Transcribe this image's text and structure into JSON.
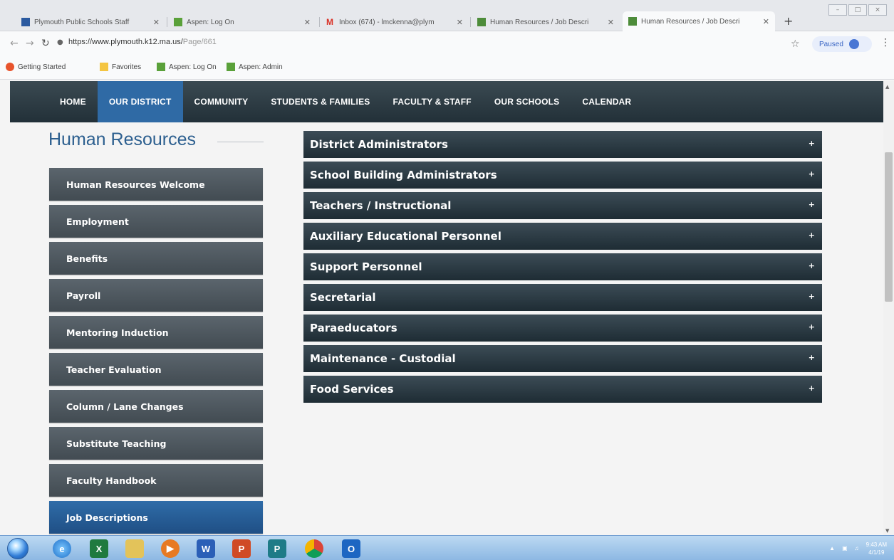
{
  "browser": {
    "tabs": [
      {
        "title": "Plymouth Public Schools Staff",
        "active": false
      },
      {
        "title": "Aspen: Log On",
        "active": false
      },
      {
        "title": "Inbox (674) - lmckenna@plym",
        "active": false
      },
      {
        "title": "Human Resources / Job Descri",
        "active": false
      },
      {
        "title": "Human Resources / Job Descri",
        "active": true
      }
    ],
    "new_tab": "+",
    "url_main": "https://www.plymouth.k12.ma.us/",
    "url_path": "Page/661",
    "profile_label": "Paused",
    "bookmarks": [
      "Getting Started",
      "Favorites",
      "Aspen: Log On",
      "Aspen: Admin"
    ]
  },
  "site_nav": {
    "items": [
      "HOME",
      "OUR DISTRICT",
      "COMMUNITY",
      "STUDENTS & FAMILIES",
      "FACULTY & STAFF",
      "OUR SCHOOLS",
      "CALENDAR"
    ],
    "active": "OUR DISTRICT"
  },
  "sidebar": {
    "title": "Human Resources",
    "items": [
      "Human Resources Welcome",
      "Employment",
      "Benefits",
      "Payroll",
      "Mentoring Induction",
      "Teacher Evaluation",
      "Column / Lane Changes",
      "Substitute Teaching",
      "Faculty Handbook",
      "Job Descriptions"
    ],
    "active": "Job Descriptions"
  },
  "accordion": {
    "items": [
      "District Administrators",
      "School Building Administrators",
      "Teachers / Instructional",
      "Auxiliary Educational Personnel",
      "Support Personnel",
      "Secretarial",
      "Paraeducators",
      "Maintenance - Custodial",
      "Food Services"
    ],
    "expand_symbol": "+"
  },
  "taskbar": {
    "apps": [
      "internet-explorer",
      "excel",
      "file-explorer",
      "media-player",
      "word",
      "powerpoint",
      "publisher",
      "chrome",
      "outlook"
    ],
    "clock_time": "9:43 AM",
    "clock_date": "4/1/19"
  },
  "colors": {
    "nav_bg": "#2a3940",
    "nav_active": "#2f6aa5",
    "sidebar_btn": "#4f5961",
    "sidebar_active": "#2a5f98",
    "accordion_bg": "#2c3b44",
    "title_blue": "#2c5f8f"
  }
}
